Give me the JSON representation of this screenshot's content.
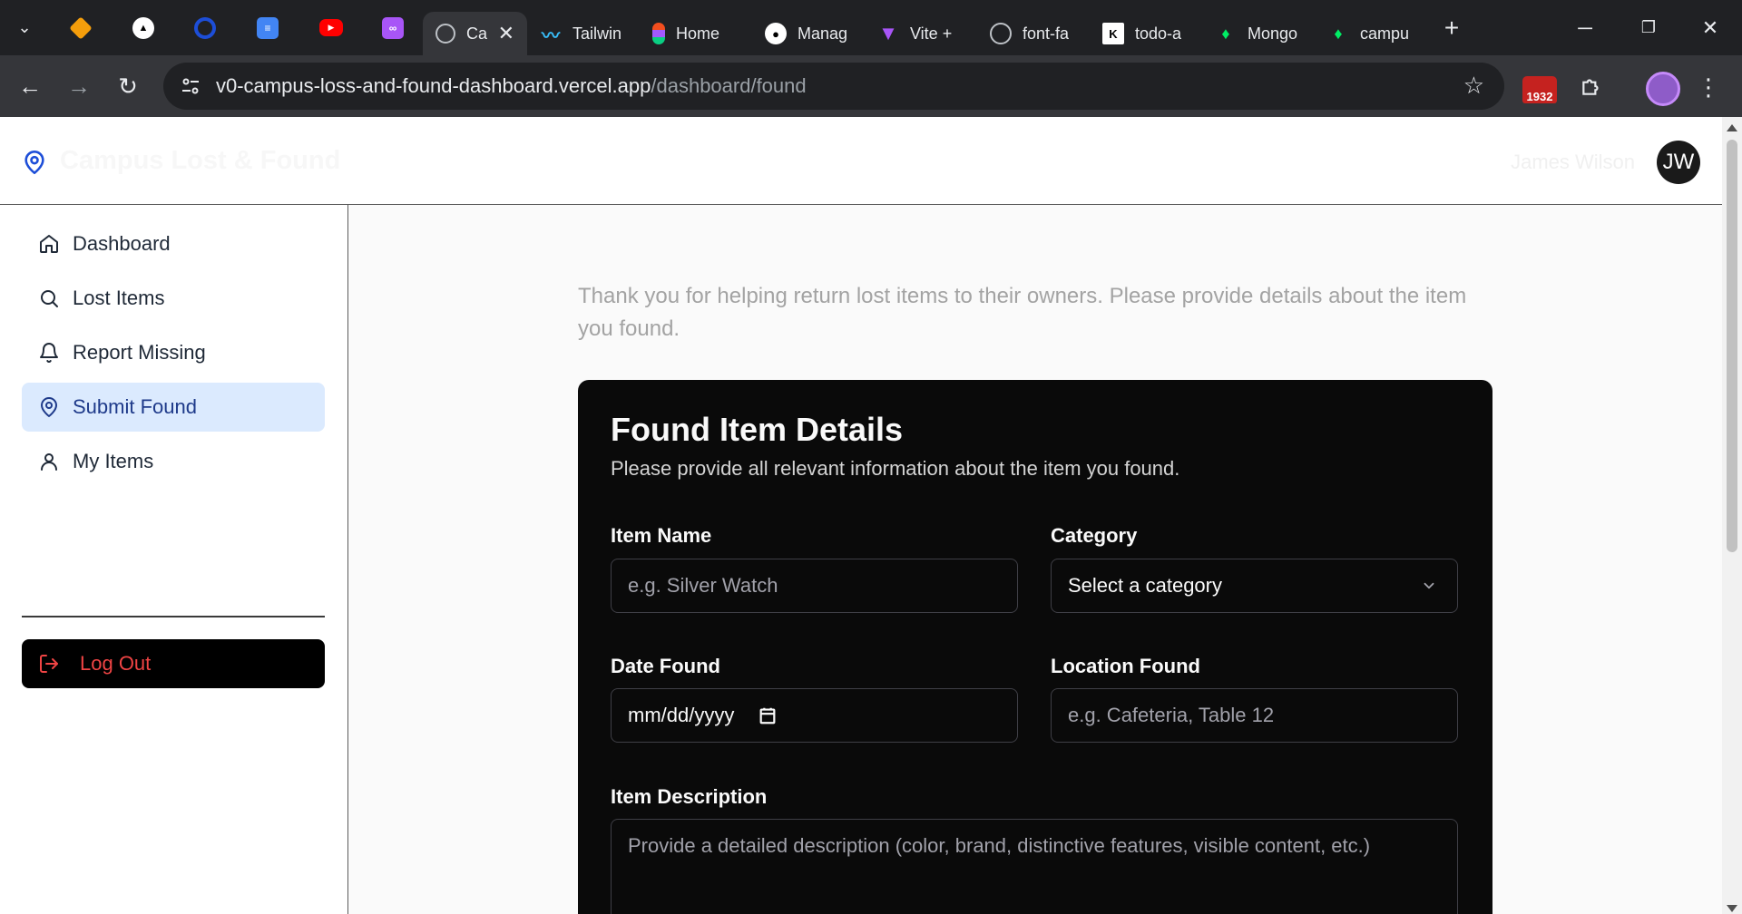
{
  "browser": {
    "pinned_tabs": [
      {
        "icon": "cube-orange-icon",
        "color": "#f59e0b"
      },
      {
        "icon": "triangle-logo-icon",
        "color": "#ffffff"
      },
      {
        "icon": "ring-logo-icon",
        "color": "#1d4ed8"
      },
      {
        "icon": "google-docs-icon",
        "color": "#4285f4"
      },
      {
        "icon": "youtube-icon",
        "color": "#ff0000"
      },
      {
        "icon": "purple-app-icon",
        "color": "#a855f7"
      }
    ],
    "tabs": [
      {
        "label": "Ca",
        "icon": "globe-icon",
        "active": true
      },
      {
        "label": "Tailwin",
        "icon": "tailwind-icon"
      },
      {
        "label": "Home",
        "icon": "figma-icon"
      },
      {
        "label": "Manag",
        "icon": "github-icon"
      },
      {
        "label": "Vite +",
        "icon": "vite-icon"
      },
      {
        "label": "font-fa",
        "icon": "font-awesome-icon"
      },
      {
        "label": "todo-a",
        "icon": "k-logo-icon"
      },
      {
        "label": "Mongo",
        "icon": "mongodb-leaf-icon"
      },
      {
        "label": "campu",
        "icon": "mongodb-leaf-icon"
      }
    ],
    "new_tab": "+",
    "address": {
      "host": "v0-campus-loss-and-found-dashboard.vercel.app",
      "path": "/dashboard/found"
    },
    "extension_badge": "1932"
  },
  "app": {
    "brand": "Campus Lost & Found",
    "user_name": "James Wilson",
    "avatar_initials": "JW",
    "accent_color": "#1d4ed8"
  },
  "sidebar": {
    "items": [
      {
        "label": "Dashboard",
        "icon": "home-icon"
      },
      {
        "label": "Lost Items",
        "icon": "search-icon"
      },
      {
        "label": "Report Missing",
        "icon": "bell-icon"
      },
      {
        "label": "Submit Found",
        "icon": "map-pin-icon",
        "active": true
      },
      {
        "label": "My Items",
        "icon": "user-icon"
      }
    ],
    "logout_label": "Log Out"
  },
  "main": {
    "intro": "Thank you for helping return lost items to their owners. Please provide details about the item you found.",
    "card": {
      "title": "Found Item Details",
      "subtitle": "Please provide all relevant information about the item you found.",
      "fields": {
        "item_name": {
          "label": "Item Name",
          "placeholder": "e.g. Silver Watch"
        },
        "category": {
          "label": "Category",
          "value": "Select a category"
        },
        "date_found": {
          "label": "Date Found",
          "value": "mm/dd/yyyy"
        },
        "location_found": {
          "label": "Location Found",
          "placeholder": "e.g. Cafeteria, Table 12"
        },
        "description": {
          "label": "Item Description",
          "placeholder": "Provide a detailed description (color, brand, distinctive features, visible content, etc.)"
        }
      }
    }
  }
}
